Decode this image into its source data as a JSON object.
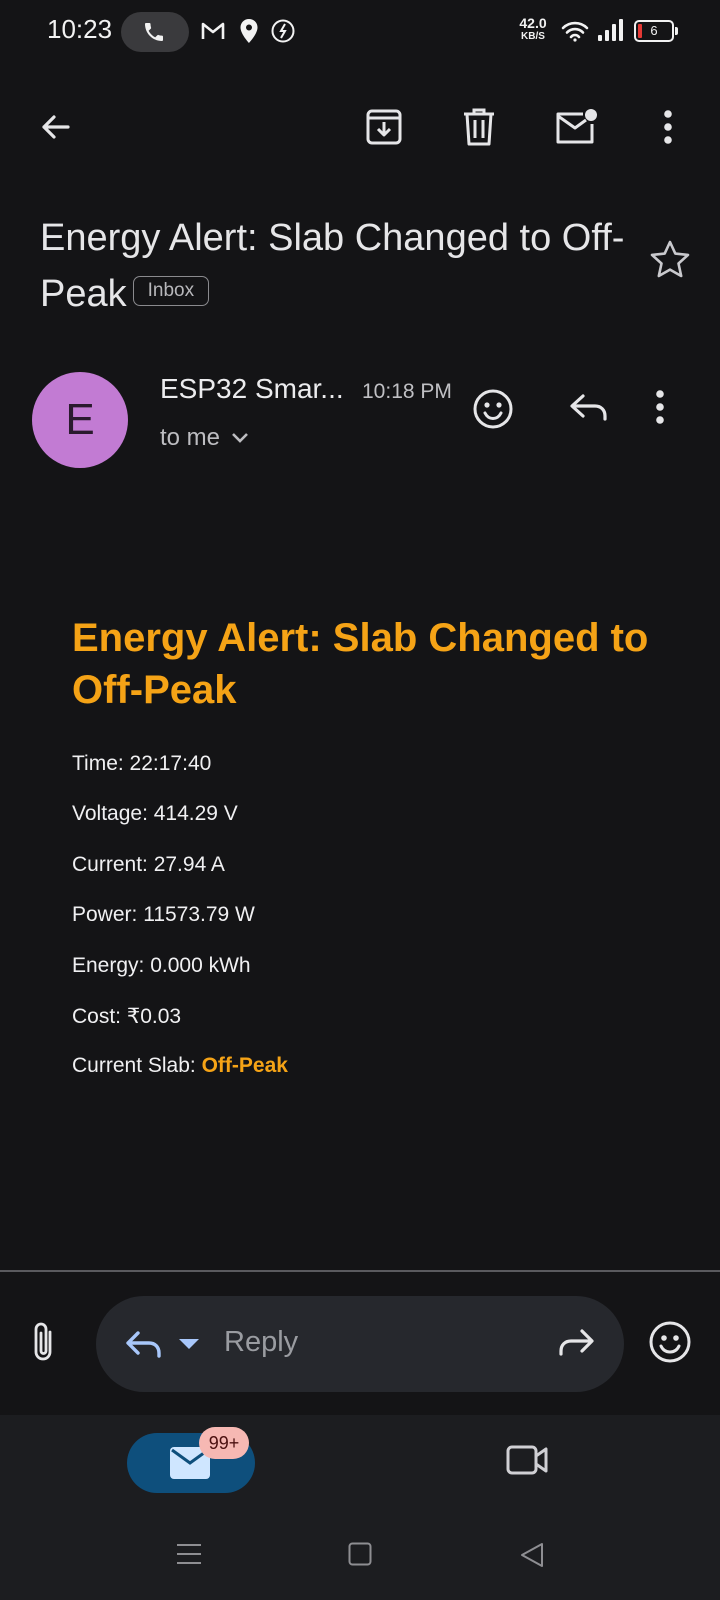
{
  "status_bar": {
    "time": "10:23",
    "net_speed_value": "42.0",
    "net_speed_unit": "KB/S",
    "battery_level": "6",
    "icons": [
      "phone-icon",
      "gmail-icon",
      "maps-icon",
      "clock-icon",
      "wifi-icon",
      "signal-icon",
      "battery-icon"
    ]
  },
  "toolbar": {
    "icons": [
      "back-arrow-icon",
      "archive-icon",
      "delete-icon",
      "mark-unread-icon",
      "more-vert-icon"
    ]
  },
  "email": {
    "subject": "Energy Alert: Slab Changed to Off-Peak",
    "label": "Inbox",
    "sender_initial": "E",
    "sender_name": "ESP32 Smar...",
    "sent_time": "10:18 PM",
    "recipient": "to me"
  },
  "body": {
    "heading": "Energy Alert: Slab Changed to Off-Peak",
    "time_line": "Time: 22:17:40",
    "voltage_line": "Voltage: 414.29 V",
    "current_line": "Current: 27.94 A",
    "power_line": "Power: 11573.79 W",
    "energy_line": "Energy: 0.000 kWh",
    "cost_line": "Cost: ₹0.03",
    "slab_label": "Current Slab: ",
    "slab_value": "Off-Peak"
  },
  "reply_bar": {
    "placeholder": "Reply"
  },
  "bottom_nav": {
    "mail_badge": "99+"
  },
  "colors": {
    "accent_orange": "#f5a316",
    "background": "#141416",
    "avatar": "#c27bd3",
    "mail_tab": "#0e4f7c",
    "badge": "#f6b8b3"
  }
}
